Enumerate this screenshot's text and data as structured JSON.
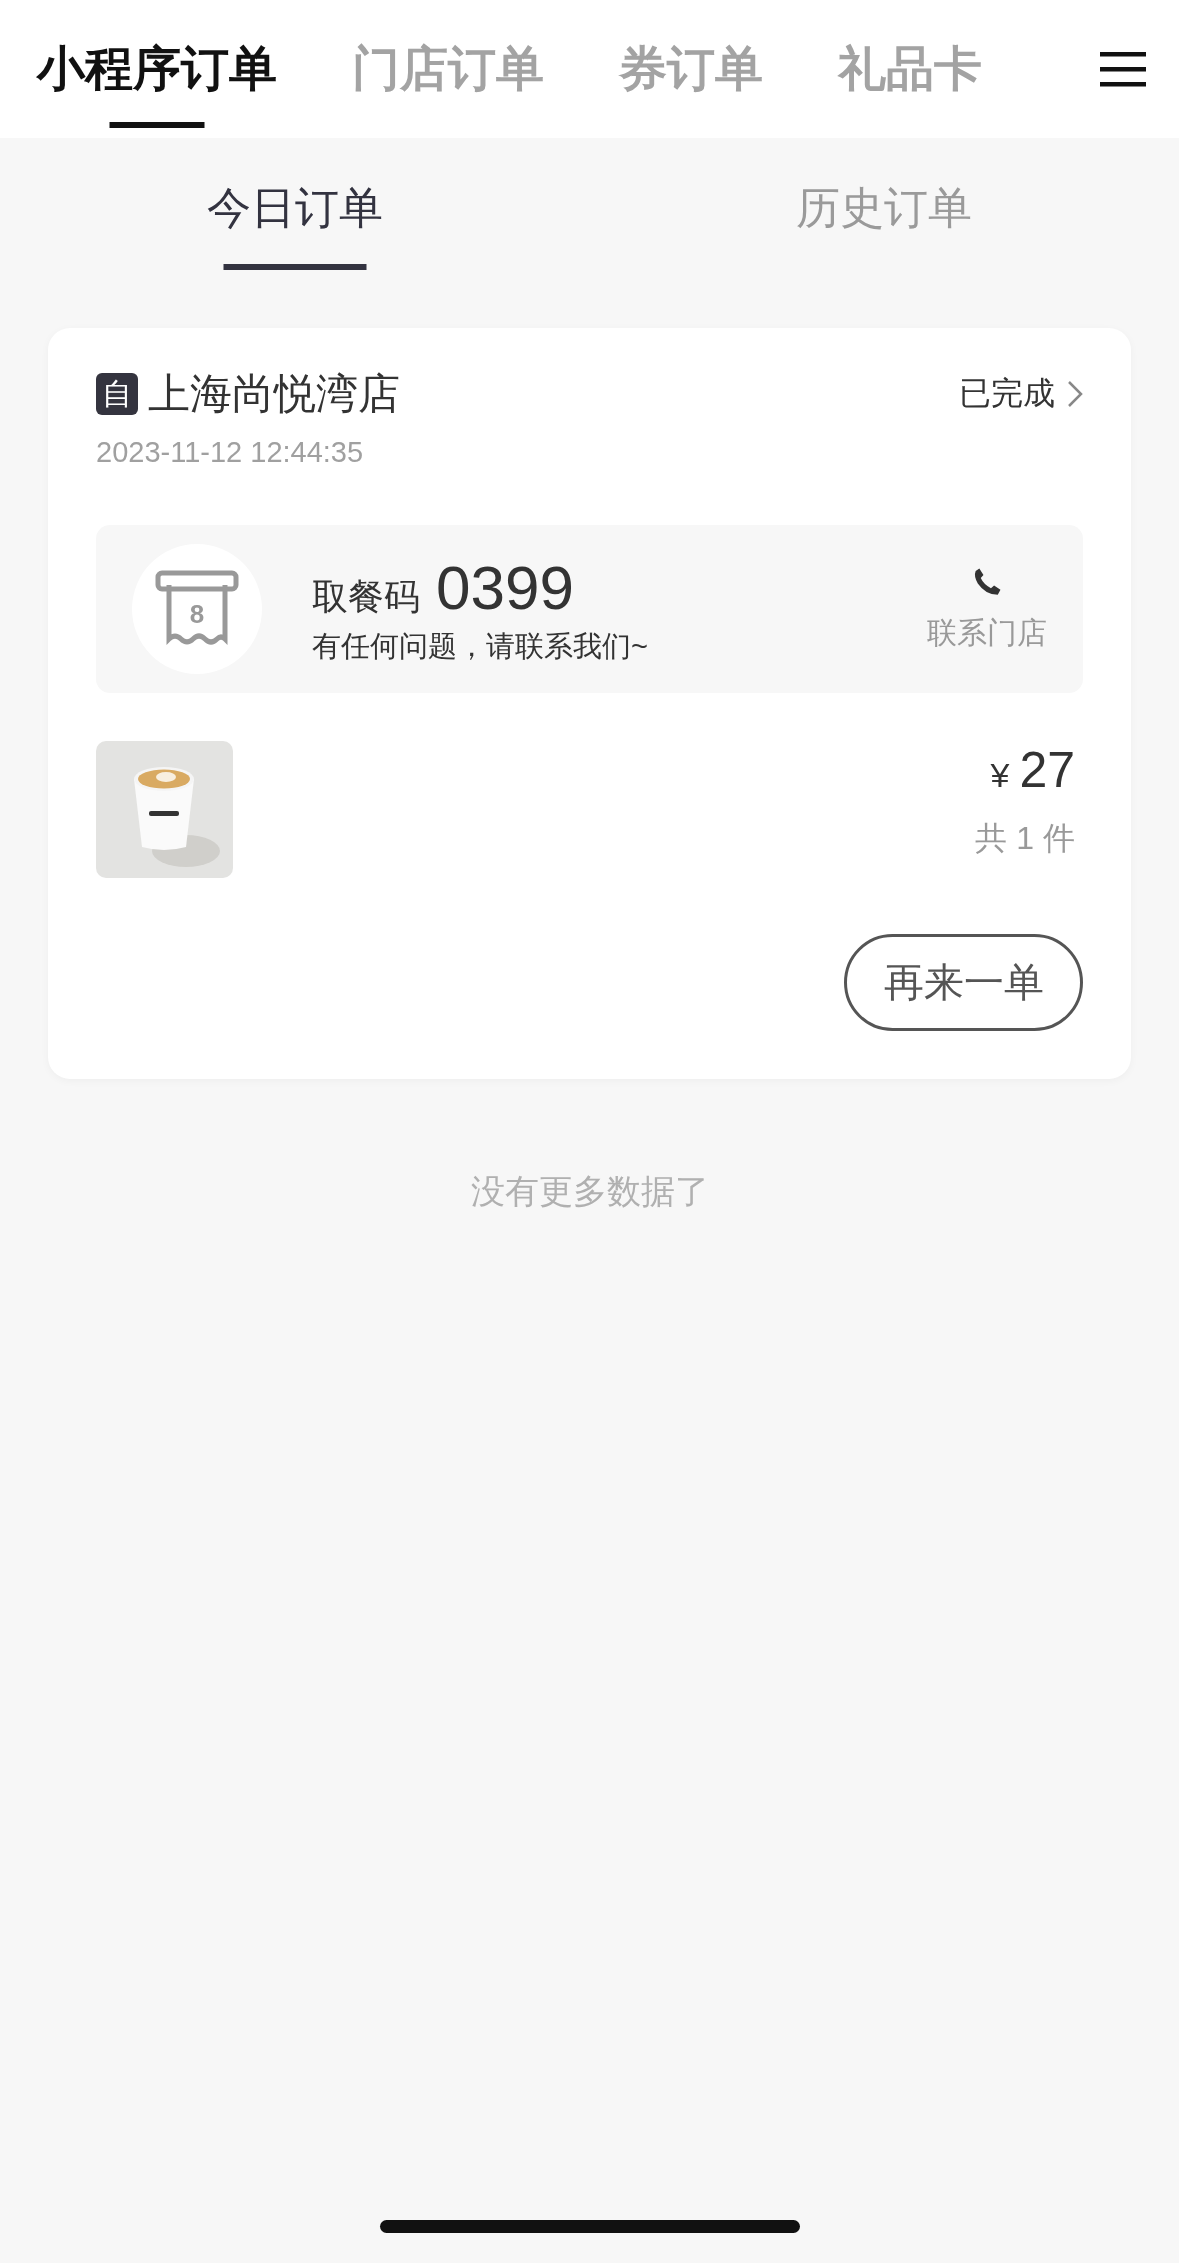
{
  "top_tabs": [
    {
      "label": "小程序订单",
      "selected": true
    },
    {
      "label": "门店订单",
      "selected": false
    },
    {
      "label": "券订单",
      "selected": false
    },
    {
      "label": "礼品卡",
      "selected": false
    }
  ],
  "sub_tabs": [
    {
      "label": "今日订单",
      "selected": true
    },
    {
      "label": "历史订单",
      "selected": false
    }
  ],
  "orders": [
    {
      "store_badge": "自",
      "store": "上海尚悦湾店",
      "status": "已完成",
      "datetime": "2023-11-12 12:44:35",
      "pickup_label": "取餐码",
      "pickup_code": "0399",
      "pickup_ticket_number": "8",
      "help_text": "有任何问题，请联系我们~",
      "contact_label": "联系门店",
      "currency": "¥",
      "price": "27",
      "count": "共 1 件",
      "reorder_button": "再来一单"
    }
  ],
  "footer_note": "没有更多数据了"
}
